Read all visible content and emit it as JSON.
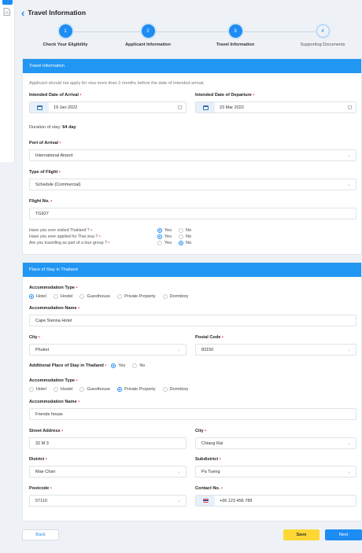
{
  "header": {
    "back_icon": "chevron-left-icon",
    "title": "Travel Information"
  },
  "colors": {
    "accent": "#1d8cf3",
    "section_header": "#2196f3",
    "required": "#e53935",
    "save": "#fdd835"
  },
  "steps": [
    {
      "number": "1",
      "label": "Check Your Eligibility",
      "state": "done"
    },
    {
      "number": "2",
      "label": "Applicant Information",
      "state": "done"
    },
    {
      "number": "3",
      "label": "Travel Information",
      "state": "current"
    },
    {
      "number": "4",
      "label": "Supporting Documents",
      "state": "pending"
    }
  ],
  "travel": {
    "section_title": "Travel Information",
    "note": "Applicant should not apply for visa more than 3 months before the date of intended arrival.",
    "arrival_label": "Intended Date of Arrival",
    "arrival_value": "19 Jan 2022",
    "departure_label": "Intended Date of Departure",
    "departure_value": "23 Mar 2022",
    "duration_label": "Duration of stay:",
    "duration_value": "64 day",
    "port_label": "Port of Arrival",
    "port_value": "International Airport",
    "flight_type_label": "Type of Flight",
    "flight_type_value": "Schedule (Commercial)",
    "flight_no_label": "Flight No.",
    "flight_no_value": "TG927",
    "questions": [
      {
        "text": "Have you ever visited Thailand ?",
        "yes": "Yes",
        "no": "No",
        "answer": "yes"
      },
      {
        "text": "Have you ever applied for Thai visa ?",
        "yes": "Yes",
        "no": "No",
        "answer": "yes"
      },
      {
        "text": "Are you travelling as part of a tour group ?",
        "yes": "Yes",
        "no": "No",
        "answer": "no"
      }
    ]
  },
  "stay": {
    "section_title": "Place of Stay in Thailand",
    "acc_type_label": "Accommodation Type",
    "acc_options": [
      "Hotel",
      "Hostel",
      "Guesthouse",
      "Private Property",
      "Dormitory"
    ],
    "acc1_selected": "Hotel",
    "acc_name_label": "Accommodation Name",
    "acc1_name": "Cape Sienna Hotel",
    "city_label": "City",
    "city_value": "Phuket",
    "postal_label": "Postal Code",
    "postal_value": "83150",
    "additional_label": "Additional Place of Stay in Thailand",
    "additional_yes": "Yes",
    "additional_no": "No",
    "additional_answer": "yes",
    "acc2_selected": "Private Property",
    "acc2_name": "Friends house",
    "street_label": "Street Address",
    "street_value": "32 M 3",
    "city2_label": "City",
    "city2_value": "Chiang Rai",
    "district_label": "District",
    "district_value": "Mae Chan",
    "subdistrict_label": "Subdistrict",
    "subdistrict_value": "Pa Tueng",
    "postcode_label": "Postcode",
    "postcode_value": "57110",
    "contact_label": "Contact No.",
    "contact_value": "+66 123 456 789"
  },
  "footer": {
    "back": "Back",
    "save": "Save",
    "next": "Next"
  }
}
